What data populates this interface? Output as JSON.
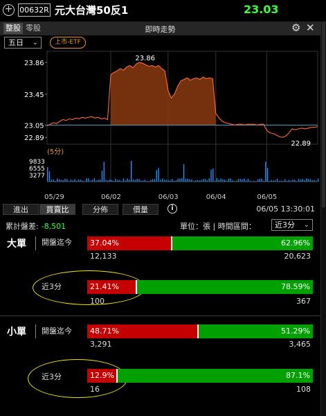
{
  "header": {
    "add_icon": "plus-circle-icon",
    "code": "00632R",
    "name": "元大台灣50反1",
    "price": "23.03",
    "price_color": "#3cff3c"
  },
  "chart_panel": {
    "seg_board": "整股",
    "seg_odd": "零股",
    "title": "即時走勢",
    "range_select": "五日",
    "market_tag": "上市-ETF",
    "gear_icon": "gear-icon",
    "close_icon": "close-icon"
  },
  "chart_data": {
    "type": "line",
    "price": {
      "yticks": [
        "23.86",
        "23.45",
        "23.05",
        "22.89"
      ],
      "ylim": [
        22.82,
        23.95
      ],
      "high_label": "23.86",
      "low_label": "22.89",
      "reference": 23.05,
      "line_color": "#ff6a3a",
      "fill_color": "#8a3a10",
      "series": [
        23.04,
        23.06,
        23.08,
        23.07,
        23.1,
        23.12,
        23.11,
        23.13,
        23.12,
        23.14,
        23.13,
        23.15,
        23.14,
        23.15,
        23.16,
        23.14,
        23.15,
        23.13,
        23.14,
        23.12,
        23.7,
        23.73,
        23.75,
        23.78,
        23.76,
        23.8,
        23.82,
        23.79,
        23.84,
        23.86,
        23.85,
        23.83,
        23.81,
        23.82,
        23.8,
        23.82,
        23.78,
        23.75,
        23.5,
        23.4,
        23.45,
        23.55,
        23.62,
        23.64,
        23.66,
        23.63,
        23.65,
        23.66,
        23.64,
        23.67,
        23.65,
        23.66,
        23.65,
        23.2,
        23.14,
        23.1,
        23.08,
        23.07,
        23.06,
        23.05,
        23.06,
        23.06,
        23.05,
        23.06,
        23.06,
        23.06,
        23.05,
        23.06,
        23.06,
        22.98,
        22.95,
        22.94,
        22.92,
        22.9,
        22.89,
        22.91,
        22.95,
        23.0,
        22.99,
        23.0,
        23.01,
        23.0,
        23.01,
        23.02,
        23.02,
        23.03
      ]
    },
    "period_label": "(5分)",
    "volume": {
      "yticks": [
        "9833",
        "6555",
        "3277"
      ],
      "ylim": [
        0,
        9833
      ],
      "bar_color": "#1e90ff"
    },
    "x_labels": [
      "05/29",
      "06/02",
      "06/03",
      "06/04",
      "06/05"
    ]
  },
  "tabs": [
    "進出",
    "買賣比",
    "分佈",
    "價量"
  ],
  "active_tab": "買賣比",
  "info_icon": "info-icon",
  "timestamp": "06/05 13:30:01",
  "summary": {
    "cumulative_label": "累計盤差:",
    "cumulative_value": "-8,501",
    "unit_label": "單位：張 | 時間區間：",
    "interval": "近3分"
  },
  "large": {
    "title": "大單",
    "since_open": {
      "label": "開盤迄今",
      "buy_pct": "37.04%",
      "sell_pct": "62.96%",
      "buy_ratio": 0.3704,
      "buy_qty": "12,133",
      "sell_qty": "20,623"
    },
    "recent": {
      "label": "近3分",
      "buy_pct": "21.41%",
      "sell_pct": "78.59%",
      "buy_ratio": 0.2141,
      "buy_qty": "100",
      "sell_qty": "367"
    }
  },
  "small": {
    "title": "小單",
    "since_open": {
      "label": "開盤迄今",
      "buy_pct": "48.71%",
      "sell_pct": "51.29%",
      "buy_ratio": 0.4871,
      "buy_qty": "3,291",
      "sell_qty": "3,465"
    },
    "recent": {
      "label": "近3分",
      "buy_pct": "12.9%",
      "sell_pct": "87.1%",
      "buy_ratio": 0.129,
      "buy_qty": "16",
      "sell_qty": "108"
    }
  },
  "colors": {
    "buy": "#c40000",
    "sell": "#00a000",
    "highlight": "#f0e40c"
  }
}
